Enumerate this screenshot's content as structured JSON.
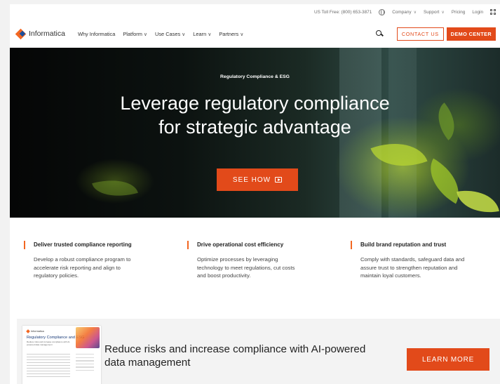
{
  "utility_bar": {
    "toll_free": "US Toll Free: (800) 653-3871",
    "company": "Company",
    "support": "Support",
    "pricing": "Pricing",
    "login": "Login",
    "icons": [
      "globe-icon",
      "chevron-down-icon",
      "grid-menu-icon"
    ]
  },
  "nav": {
    "logo_text": "Informatica",
    "items": [
      {
        "label": "Why Informatica",
        "has_dropdown": false
      },
      {
        "label": "Platform",
        "has_dropdown": true
      },
      {
        "label": "Use Cases",
        "has_dropdown": true
      },
      {
        "label": "Learn",
        "has_dropdown": true
      },
      {
        "label": "Partners",
        "has_dropdown": true
      }
    ],
    "chevron": "∨",
    "contact_us": "CONTACT US",
    "demo_center": "DEMO CENTER"
  },
  "hero": {
    "eyebrow": "Regulatory Compliance & ESG",
    "title_line1": "Leverage regulatory compliance",
    "title_line2": "for strategic advantage",
    "cta": "SEE HOW"
  },
  "features": [
    {
      "title": "Deliver trusted compliance reporting",
      "desc_lines": [
        "Develop a robust compliance program to",
        "accelerate risk reporting and align to",
        "regulatory policies."
      ]
    },
    {
      "title": "Drive operational cost efficiency",
      "desc_lines": [
        "Optimize processes by leveraging",
        "technology to meet regulations, cut costs",
        "and boost productivity."
      ]
    },
    {
      "title": "Build brand reputation and trust",
      "desc_lines": [
        "Comply with standards, safeguard data and",
        "assure trust to strengthen reputation and",
        "maintain loyal customers."
      ]
    }
  ],
  "banner": {
    "doc_brand": "Informatica",
    "doc_title": "Regulatory Compliance and ESG",
    "doc_subtitle": "Reduce risks and increase compliance with AI-powered data management",
    "text_line1": "Reduce risks and increase compliance with AI-powered",
    "text_line2": "data management",
    "cta": "LEARN MORE"
  },
  "colors": {
    "accent": "#e24a1a",
    "logo_orange": "#f26722",
    "logo_blue": "#1b4f9c"
  }
}
